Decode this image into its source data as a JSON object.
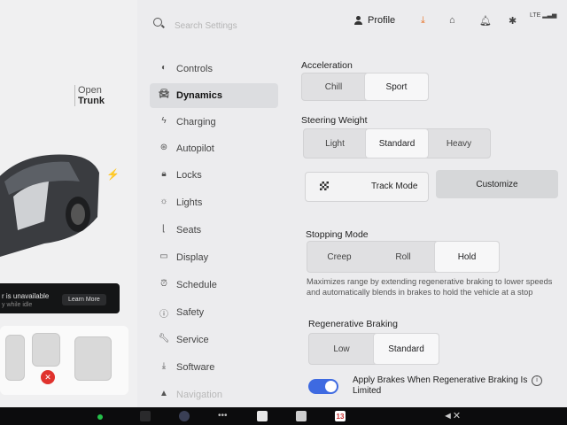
{
  "car_panel": {
    "trunk_line1": "Open",
    "trunk_line2": "Trunk",
    "banner_line1": "r is unavailable",
    "banner_line2": "y while idle",
    "learn_more": "Learn More"
  },
  "topbar": {
    "search_placeholder": "Search Settings",
    "profile_label": "Profile"
  },
  "sidebar": {
    "items": [
      {
        "label": "Controls",
        "icon": "toggle-icon"
      },
      {
        "label": "Dynamics",
        "icon": "car-icon"
      },
      {
        "label": "Charging",
        "icon": "bolt-icon"
      },
      {
        "label": "Autopilot",
        "icon": "steering-wheel-icon"
      },
      {
        "label": "Locks",
        "icon": "lock-icon"
      },
      {
        "label": "Lights",
        "icon": "sun-icon"
      },
      {
        "label": "Seats",
        "icon": "seat-icon"
      },
      {
        "label": "Display",
        "icon": "display-icon"
      },
      {
        "label": "Schedule",
        "icon": "alarm-clock-icon"
      },
      {
        "label": "Safety",
        "icon": "info-circle-icon"
      },
      {
        "label": "Service",
        "icon": "wrench-icon"
      },
      {
        "label": "Software",
        "icon": "download-icon"
      },
      {
        "label": "Navigation",
        "icon": "navigation-arrow-icon"
      }
    ],
    "active": "Dynamics"
  },
  "dynamics": {
    "acceleration": {
      "label": "Acceleration",
      "options": [
        "Chill",
        "Sport"
      ],
      "selected": "Sport"
    },
    "steering": {
      "label": "Steering Weight",
      "options": [
        "Light",
        "Standard",
        "Heavy"
      ],
      "selected": "Standard"
    },
    "track_mode": "Track Mode",
    "customize": "Customize",
    "stopping": {
      "label": "Stopping Mode",
      "options": [
        "Creep",
        "Roll",
        "Hold"
      ],
      "selected": "Hold",
      "description": "Maximizes range by extending regenerative braking to lower speeds and automatically blends in brakes to hold the vehicle at a stop"
    },
    "regen": {
      "label": "Regenerative Braking",
      "options": [
        "Low",
        "Standard"
      ],
      "selected": "Standard"
    },
    "apply_brakes": {
      "label": "Apply Brakes When Regenerative Braking Is Limited",
      "enabled": true
    }
  },
  "dock": {
    "calendar_day": "13",
    "accent": "#3e6ae1"
  }
}
